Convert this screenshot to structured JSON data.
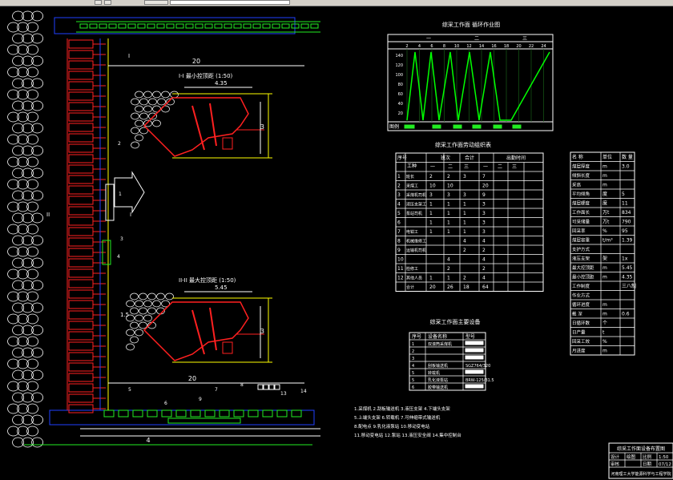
{
  "colors": {
    "red": "#ff2020",
    "green": "#22ee22",
    "white": "#ffffff",
    "blue": "#2040ff",
    "yellow": "#ffff00",
    "bright_green": "#00ff00"
  },
  "toolbar": {
    "icons": [
      "layer-icon",
      "layer-state-icon",
      "color-swatch-icon"
    ]
  },
  "plan": {
    "label_20_top": "20",
    "label_20_bottom": "20",
    "label_4": "4",
    "section_I": "I",
    "section_II": "II",
    "section_I_left": "I",
    "callout_1": "1",
    "callout_2": "2",
    "callout_3": "3",
    "callout_4": "4",
    "callout_5": "5",
    "callout_6": "6",
    "callout_7": "7",
    "callout_8": "8",
    "callout_9": "9",
    "callout_13": "13",
    "callout_14": "14",
    "dim_15": "1.5"
  },
  "section1": {
    "title": "I-I  最小控顶距 (1:50)",
    "width": "4.35",
    "height": "3"
  },
  "section2": {
    "title": "II-II 最大控顶距 (1:50)",
    "width": "5.45",
    "height": "3"
  },
  "cycle": {
    "title": "综采工作面 循环作业图",
    "shifts": [
      "一",
      "二",
      "三"
    ],
    "hours": [
      "2",
      "4",
      "6",
      "8",
      "10",
      "12",
      "14",
      "16",
      "18",
      "20",
      "22",
      "24"
    ],
    "y_ticks": [
      "140",
      "120",
      "100",
      "80",
      "60",
      "40",
      "20"
    ],
    "row_label": "图例"
  },
  "staff": {
    "title": "综采工作面劳动组织表",
    "header": {
      "no": "序号",
      "job": "工种",
      "shift": "班次",
      "total": "合计",
      "time": "出勤时间"
    },
    "shift_cols": [
      "一",
      "二",
      "三"
    ],
    "rows": [
      [
        "1",
        "班长",
        "2",
        "2",
        "3",
        "7"
      ],
      [
        "2",
        "采煤工",
        "10",
        "10",
        "",
        "20"
      ],
      [
        "3",
        "采煤机司机",
        "3",
        "3",
        "3",
        "9"
      ],
      [
        "4",
        "液压支架工",
        "1",
        "1",
        "1",
        "3"
      ],
      [
        "5",
        "泵站司机",
        "1",
        "1",
        "1",
        "3"
      ],
      [
        "6",
        "",
        "1",
        "1",
        "1",
        "3"
      ],
      [
        "7",
        "电钳工",
        "1",
        "1",
        "1",
        "3"
      ],
      [
        "8",
        "机械维修工",
        "",
        "",
        "4",
        "4"
      ],
      [
        "9",
        "运输机司机",
        "",
        "",
        "2",
        "2"
      ],
      [
        "10",
        "",
        "",
        "4",
        "",
        "4"
      ],
      [
        "11",
        "检修工",
        "",
        "2",
        "",
        "2"
      ],
      [
        "12",
        "其他人员",
        "1",
        "1",
        "2",
        "4"
      ],
      [
        "",
        "合计",
        "20",
        "26",
        "18",
        "64"
      ]
    ]
  },
  "equipment": {
    "title": "综采工作面主要设备",
    "header": [
      "序号",
      "设备名称",
      "型号"
    ],
    "rows": [
      [
        "1",
        "双滚筒采煤机",
        ""
      ],
      [
        "2",
        "",
        ""
      ],
      [
        "3",
        "",
        ""
      ],
      [
        "4",
        "刮板输送机",
        "SGZ764/320"
      ],
      [
        "5",
        "转载机",
        ""
      ],
      [
        "5",
        "乳化液泵站",
        "BRW-125/31.5"
      ],
      [
        "6",
        "胶带输送机",
        ""
      ]
    ]
  },
  "params": {
    "header": [
      "名 称",
      "单位",
      "数 量"
    ],
    "rows": [
      [
        "煤层厚度",
        "m",
        "3.0"
      ],
      [
        "倾斜长度",
        "m",
        ""
      ],
      [
        "采高",
        "m",
        ""
      ],
      [
        "平均倾角",
        "度",
        "5"
      ],
      [
        "煤层硬度",
        "度",
        "11"
      ],
      [
        "工作面长",
        "万t",
        "834"
      ],
      [
        "可采储量",
        "万t",
        "790"
      ],
      [
        "回采率",
        "%",
        "95"
      ],
      [
        "煤层容重",
        "t/m³",
        "1.39"
      ],
      [
        "支护方式",
        "",
        ""
      ],
      [
        "液压支架",
        "架",
        "1x"
      ],
      [
        "最大控顶距",
        "m",
        "5.45"
      ],
      [
        "最小控顶距",
        "m",
        "4.35"
      ],
      [
        "工作制度",
        "",
        "三八制"
      ],
      [
        "作业方式",
        "",
        ""
      ],
      [
        "循环进度",
        "m",
        ""
      ],
      [
        "截 深",
        "m",
        "0.6"
      ],
      [
        "日循环数",
        "个",
        ""
      ],
      [
        "日产量",
        "t",
        ""
      ],
      [
        "回采工效",
        "%",
        ""
      ],
      [
        "月进度",
        "m",
        ""
      ]
    ]
  },
  "notes": [
    "1.采煤机 2.刮板输送机 3.液压支架 4.下端头支架",
    "5.上端头支架 6.转载机 7.可伸缩带式输送机",
    "8.配电点 9.乳化液泵站 10.移动变电站",
    "11.移动变电站 12.泵站 13.液压安全阀 14.集中控制台"
  ],
  "title_block": {
    "title": "综采工作面设备布置图",
    "design_label": "设计",
    "draw_label": "绘图",
    "check_label": "审核",
    "date_label": "日期",
    "scale_label": "比例",
    "scale": "1:50",
    "date": "07/12",
    "footer": "河南理工大学能源科学与工程学院"
  }
}
